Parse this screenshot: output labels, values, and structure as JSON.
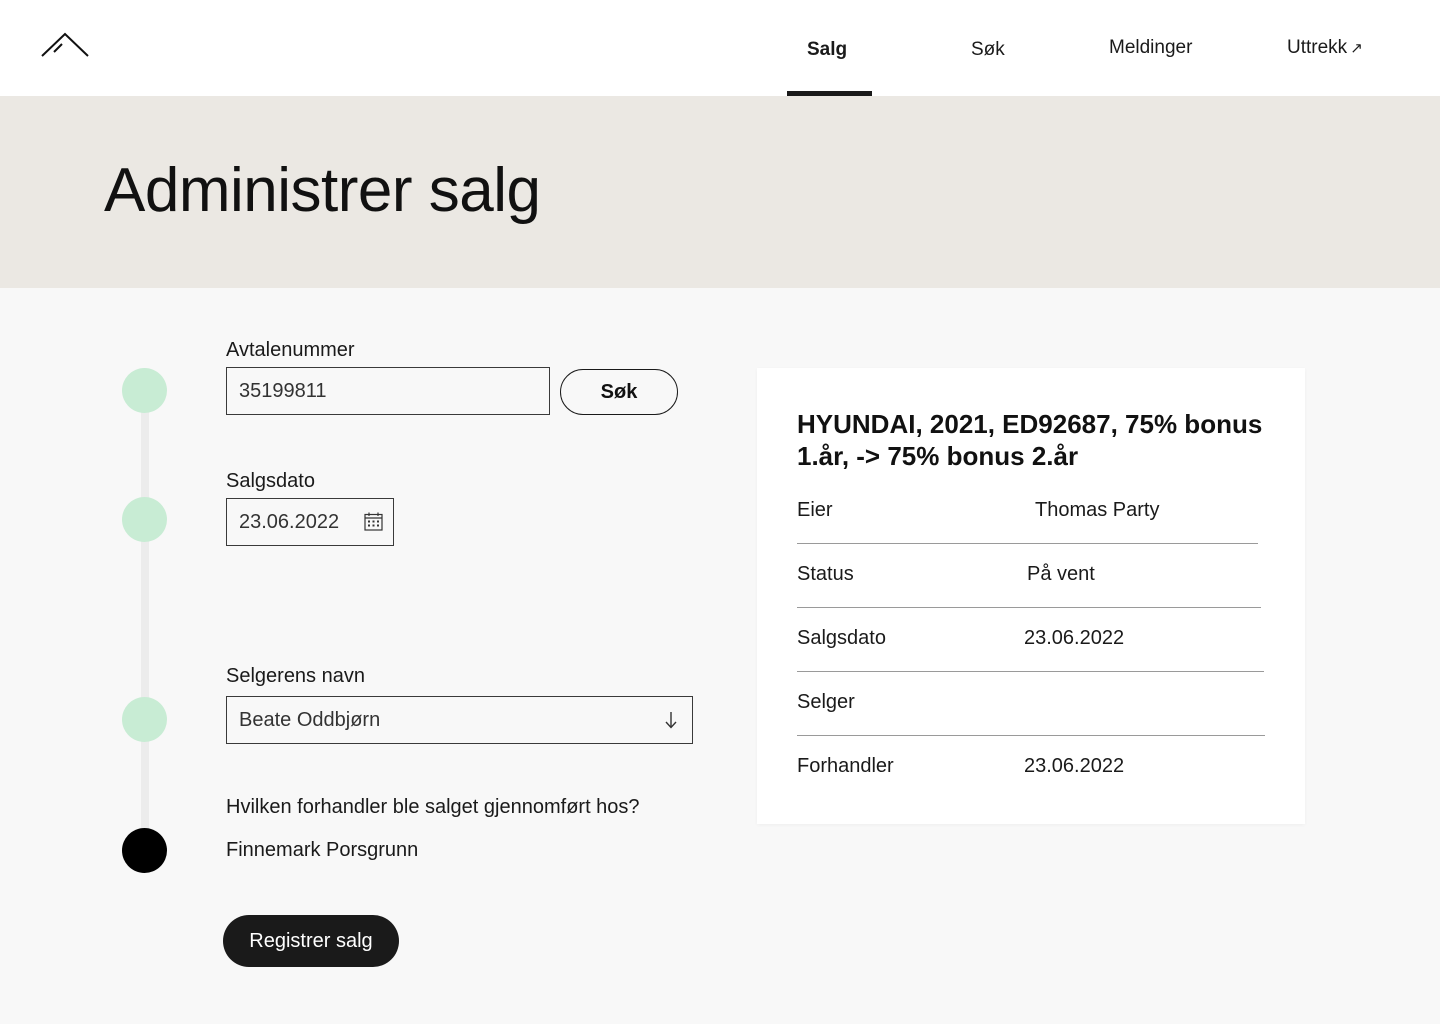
{
  "nav": {
    "logo": "home-logo",
    "items": [
      {
        "label": "Salg",
        "active": true
      },
      {
        "label": "Søk",
        "active": false
      },
      {
        "label": "Meldinger",
        "active": false
      },
      {
        "label": "Uttrekk",
        "active": false,
        "external_icon": "↗"
      }
    ]
  },
  "hero": {
    "title": "Administrer salg"
  },
  "form": {
    "avtalenummer": {
      "label": "Avtalenummer",
      "value": "35199811",
      "button": "Søk"
    },
    "salgsdato": {
      "label": "Salgsdato",
      "value": "23.06.2022",
      "icon": "calendar-icon"
    },
    "selger": {
      "label": "Selgerens navn",
      "value": "Beate Oddbjørn",
      "icon": "arrow-down-icon"
    },
    "forhandler": {
      "question": "Hvilken forhandler ble salget gjennomført hos?",
      "answer": "Finnemark Porsgrunn"
    },
    "submit": "Registrer salg"
  },
  "summary": {
    "title": "HYUNDAI, 2021, ED92687, 75% bonus 1.år, -> 75% bonus 2.år",
    "rows": [
      {
        "key": "Eier",
        "value": "Thomas Party"
      },
      {
        "key": "Status",
        "value": "På vent"
      },
      {
        "key": "Salgsdato",
        "value": "23.06.2022"
      },
      {
        "key": "Selger",
        "value": ""
      },
      {
        "key": "Forhandler",
        "value": "23.06.2022"
      }
    ]
  },
  "colors": {
    "accent": "#1a1a1a",
    "step_done": "#c8ecd4",
    "hero_bg": "#ebe8e3"
  }
}
